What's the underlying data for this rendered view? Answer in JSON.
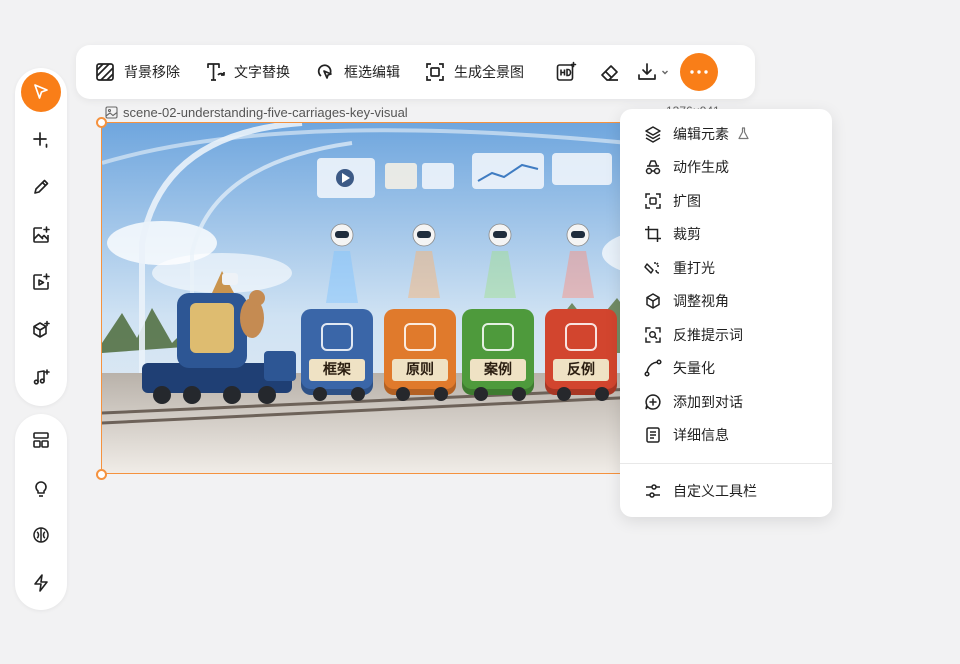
{
  "toolbar": {
    "remove_bg_label": "背景移除",
    "text_replace_label": "文字替换",
    "box_edit_label": "框选编辑",
    "panorama_label": "生成全景图",
    "hd_icon": "hd-sparkle-icon",
    "eraser_icon": "eraser-icon",
    "download_icon": "download-icon",
    "more_icon": "more-dots-icon"
  },
  "image": {
    "filename": "scene-02-understanding-five-carriages-key-visual",
    "dimensions": "1376×941",
    "cars": [
      "框架",
      "原则",
      "案例",
      "反例"
    ],
    "car_colors": [
      "#3a66a8",
      "#e07a2c",
      "#4e9a3c",
      "#d2452e"
    ]
  },
  "menu": {
    "items": [
      {
        "label": "编辑元素",
        "icon": "layers-icon",
        "badge": "flask-icon"
      },
      {
        "label": "动作生成",
        "icon": "walk-icon"
      },
      {
        "label": "扩图",
        "icon": "expand-icon"
      },
      {
        "label": "裁剪",
        "icon": "crop-icon"
      },
      {
        "label": "重打光",
        "icon": "relight-icon"
      },
      {
        "label": "调整视角",
        "icon": "cube-view-icon"
      },
      {
        "label": "反推提示词",
        "icon": "scan-prompt-icon"
      },
      {
        "label": "矢量化",
        "icon": "vector-icon"
      },
      {
        "label": "添加到对话",
        "icon": "add-chat-icon"
      },
      {
        "label": "详细信息",
        "icon": "details-icon"
      }
    ],
    "footer": {
      "label": "自定义工具栏",
      "icon": "sliders-icon"
    }
  },
  "sidebar": {
    "top_icons": [
      "select-icon",
      "add-icon",
      "pencil-icon",
      "image-gen-icon",
      "video-gen-icon",
      "3d-gen-icon",
      "music-gen-icon"
    ],
    "bottom_icons": [
      "layout-icon",
      "bulb-icon",
      "brain-icon",
      "bolt-icon"
    ]
  },
  "colors": {
    "accent": "#f97e18",
    "selection": "#f5923e"
  }
}
